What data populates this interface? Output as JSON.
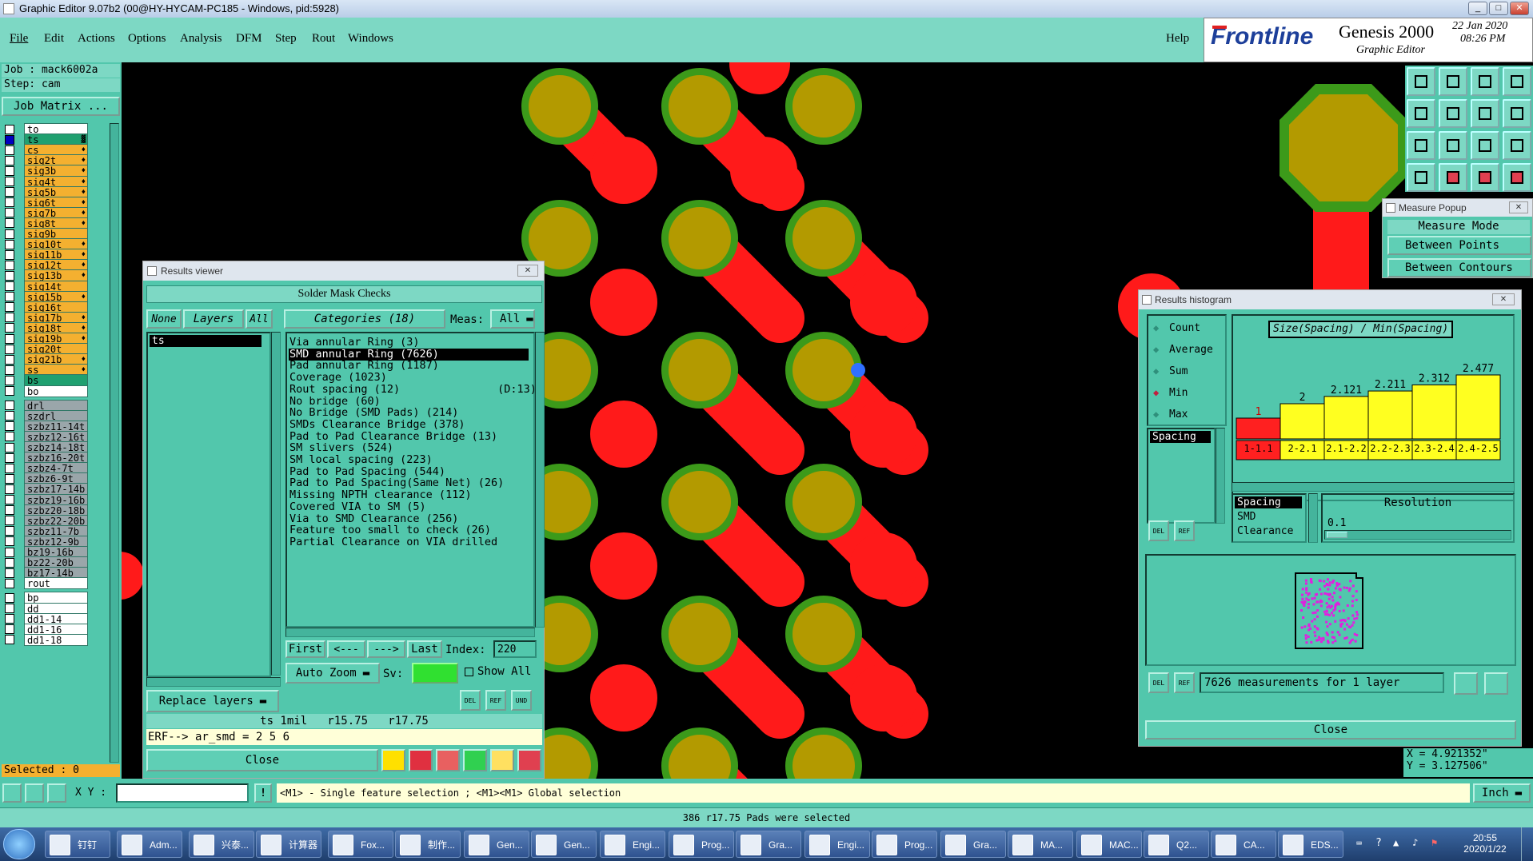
{
  "window": {
    "title": "Graphic Editor 9.07b2 (00@HY-HYCAM-PC185 - Windows, pid:5928)"
  },
  "menu": {
    "items": [
      "File",
      "Edit",
      "Actions",
      "Options",
      "Analysis",
      "DFM",
      "Step",
      "Rout",
      "Windows"
    ],
    "help": "Help"
  },
  "brand": {
    "logo": "Frontline",
    "product": "Genesis 2000",
    "subtitle": "Graphic Editor",
    "date": "22 Jan 2020",
    "time": "08:26 PM"
  },
  "job": {
    "job_label": "Job : mack6002a",
    "step_label": "Step: cam",
    "matrix_button": "Job Matrix ..."
  },
  "layers": [
    {
      "name": "to",
      "color": "#ffffff",
      "mark": ""
    },
    {
      "name": "ts",
      "color": "#20a070",
      "mark": "▓"
    },
    {
      "name": "cs",
      "color": "#f4b030",
      "mark": "♦"
    },
    {
      "name": "sig2t",
      "color": "#f4b030",
      "mark": "♦"
    },
    {
      "name": "sig3b",
      "color": "#f4b030",
      "mark": "♦"
    },
    {
      "name": "sig4t",
      "color": "#f4b030",
      "mark": "♦"
    },
    {
      "name": "sig5b",
      "color": "#f4b030",
      "mark": "♦"
    },
    {
      "name": "sig6t",
      "color": "#f4b030",
      "mark": "♦"
    },
    {
      "name": "sig7b",
      "color": "#f4b030",
      "mark": "♦"
    },
    {
      "name": "sig8t",
      "color": "#f4b030",
      "mark": "♦"
    },
    {
      "name": "sig9b",
      "color": "#f4b030",
      "mark": ""
    },
    {
      "name": "sig10t",
      "color": "#f4b030",
      "mark": "♦"
    },
    {
      "name": "sig11b",
      "color": "#f4b030",
      "mark": "♦"
    },
    {
      "name": "sig12t",
      "color": "#f4b030",
      "mark": "♦"
    },
    {
      "name": "sig13b",
      "color": "#f4b030",
      "mark": "♦"
    },
    {
      "name": "sig14t",
      "color": "#f4b030",
      "mark": ""
    },
    {
      "name": "sig15b",
      "color": "#f4b030",
      "mark": "♦"
    },
    {
      "name": "sig16t",
      "color": "#f4b030",
      "mark": ""
    },
    {
      "name": "sig17b",
      "color": "#f4b030",
      "mark": "♦"
    },
    {
      "name": "sig18t",
      "color": "#f4b030",
      "mark": "♦"
    },
    {
      "name": "sig19b",
      "color": "#f4b030",
      "mark": "♦"
    },
    {
      "name": "sig20t",
      "color": "#f4b030",
      "mark": ""
    },
    {
      "name": "sig21b",
      "color": "#f4b030",
      "mark": "♦"
    },
    {
      "name": "ss",
      "color": "#f4b030",
      "mark": "♦"
    },
    {
      "name": "bs",
      "color": "#20a070",
      "mark": ""
    },
    {
      "name": "bo",
      "color": "#ffffff",
      "mark": ""
    },
    {
      "name": "drl",
      "color": "#9aa6aa",
      "mark": ""
    },
    {
      "name": "szdrl",
      "color": "#9aa6aa",
      "mark": ""
    },
    {
      "name": "szbz11-14t",
      "color": "#9aa6aa",
      "mark": ""
    },
    {
      "name": "szbz12-16t",
      "color": "#9aa6aa",
      "mark": ""
    },
    {
      "name": "szbz14-18t",
      "color": "#9aa6aa",
      "mark": ""
    },
    {
      "name": "szbz16-20t",
      "color": "#9aa6aa",
      "mark": ""
    },
    {
      "name": "szbz4-7t",
      "color": "#9aa6aa",
      "mark": ""
    },
    {
      "name": "szbz6-9t",
      "color": "#9aa6aa",
      "mark": ""
    },
    {
      "name": "szbz17-14b",
      "color": "#9aa6aa",
      "mark": ""
    },
    {
      "name": "szbz19-16b",
      "color": "#9aa6aa",
      "mark": ""
    },
    {
      "name": "szbz20-18b",
      "color": "#9aa6aa",
      "mark": ""
    },
    {
      "name": "szbz22-20b",
      "color": "#9aa6aa",
      "mark": ""
    },
    {
      "name": "szbz11-7b",
      "color": "#9aa6aa",
      "mark": ""
    },
    {
      "name": "szbz12-9b",
      "color": "#9aa6aa",
      "mark": ""
    },
    {
      "name": "bz19-16b",
      "color": "#9aa6aa",
      "mark": ""
    },
    {
      "name": "bz22-20b",
      "color": "#9aa6aa",
      "mark": ""
    },
    {
      "name": "bz17-14b",
      "color": "#9aa6aa",
      "mark": ""
    },
    {
      "name": "rout",
      "color": "#ffffff",
      "mark": ""
    },
    {
      "name": "bp",
      "color": "#ffffff",
      "mark": ""
    },
    {
      "name": "dd",
      "color": "#ffffff",
      "mark": ""
    },
    {
      "name": "dd1-14",
      "color": "#ffffff",
      "mark": ""
    },
    {
      "name": "dd1-16",
      "color": "#ffffff",
      "mark": ""
    },
    {
      "name": "dd1-18",
      "color": "#ffffff",
      "mark": ""
    }
  ],
  "selected": "Selected : 0",
  "results_viewer": {
    "title": "Results viewer",
    "header": "Solder Mask Checks",
    "none": "None",
    "layers": "Layers",
    "all": "All",
    "categories": "Categories (18)",
    "meas_label": "Meas:",
    "meas_value": "All",
    "layer_items": [
      "ts"
    ],
    "items": [
      "Via annular Ring (3)",
      "SMD annular Ring (7626)",
      "Pad annular Ring (1187)",
      "Coverage (1023)",
      "Rout spacing (12)               (D:13)",
      "No bridge (60)",
      "No Bridge (SMD Pads) (214)",
      "SMDs Clearance Bridge (378)",
      "Pad to Pad Clearance Bridge (13)",
      "SM slivers (524)",
      "SM local spacing (223)",
      "Pad to Pad Spacing (544)",
      "Pad to Pad Spacing(Same Net) (26)",
      "Missing NPTH clearance (112)",
      "Covered VIA to SM (5)",
      "Via to SMD Clearance (256)",
      "Feature too small to check (26)",
      "Partial Clearance on VIA drilled"
    ],
    "selected_index": 1,
    "first": "First",
    "prev": "<---",
    "next": "--->",
    "last": "Last",
    "index_label": "Index:",
    "index_value": "220",
    "auto_zoom": "Auto Zoom",
    "sv_label": "Sv:",
    "show_all": "Show All",
    "replace_layers": "Replace layers",
    "status": "ts 1mil   r15.75   r17.75",
    "erf": "ERF--> ar_smd = 2 5 6",
    "close": "Close"
  },
  "measure_popup": {
    "title": "Measure Popup",
    "mode": "Measure Mode",
    "between_points": "Between Points",
    "between_contours": "Between Contours"
  },
  "histogram": {
    "title": "Results histogram",
    "options": [
      "Count",
      "Average",
      "Sum",
      "Min",
      "Max"
    ],
    "selected_option": "Min",
    "list": [
      "Spacing"
    ],
    "chart_title": "Size(Spacing) / Min(Spacing)",
    "res_list": [
      "Spacing",
      "SMD",
      "Clearance"
    ],
    "resolution_label": "Resolution",
    "resolution_value": "0.1",
    "summary": "7626 measurements for 1 layer",
    "close": "Close"
  },
  "chart_data": {
    "type": "bar",
    "title": "Size(Spacing) / Min(Spacing)",
    "categories": [
      "1-1.1",
      "2-2.1",
      "2.1-2.2",
      "2.2-2.3",
      "2.3-2.4",
      "2.4-2.5"
    ],
    "values": [
      1,
      2,
      2.121,
      2.211,
      2.312,
      2.477
    ],
    "labels": [
      "1",
      "2",
      "2.121",
      "2.211",
      "2.312",
      "2.477"
    ],
    "colors": [
      "#ff2020",
      "#ffff20",
      "#ffff20",
      "#ffff20",
      "#ffff20",
      "#ffff20"
    ]
  },
  "coords": {
    "x": "X = 4.921352\"",
    "y": "Y = 3.127506\""
  },
  "bottom": {
    "xy_label": "X Y :",
    "hint": "<M1> - Single feature selection ; <M1><M1> Global selection",
    "units": "Inch",
    "status": "386 r17.75 Pads were selected"
  },
  "taskbar": {
    "items": [
      "钉钉",
      "Adm...",
      "兴泰...",
      "计算器",
      "Fox...",
      "制作...",
      "Gen...",
      "Gen...",
      "Engi...",
      "Prog...",
      "Gra...",
      "Engi...",
      "Prog...",
      "Gra...",
      "MA...",
      "MAC...",
      "Q2...",
      "CA...",
      "EDS..."
    ],
    "clock_time": "20:55",
    "clock_date": "2020/1/22"
  }
}
